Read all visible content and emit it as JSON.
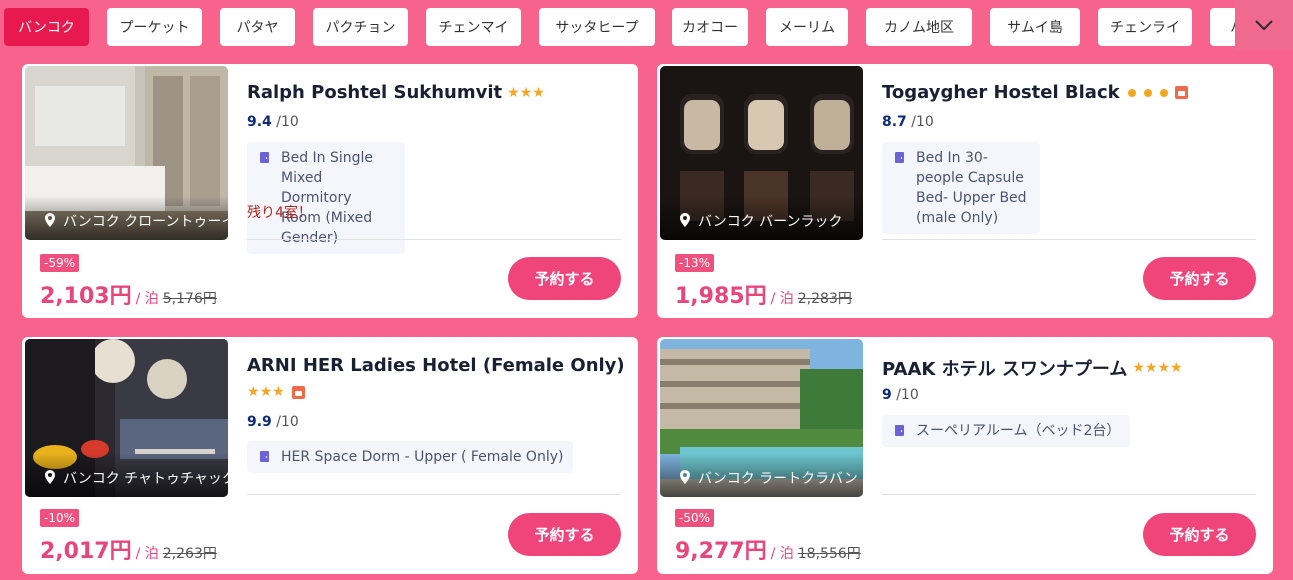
{
  "tabs": [
    {
      "label": "バンコク",
      "active": true
    },
    {
      "label": "プーケット"
    },
    {
      "label": "パタヤ"
    },
    {
      "label": "パクチョン"
    },
    {
      "label": "チェンマイ"
    },
    {
      "label": "サッタヒープ"
    },
    {
      "label": "カオコー"
    },
    {
      "label": "メーリム"
    },
    {
      "label": "カノム地区"
    },
    {
      "label": "サムイ島"
    },
    {
      "label": "チェンライ"
    },
    {
      "label": "ハ"
    }
  ],
  "tab_toggle_icon": "chevron-down-icon",
  "cta_label": "予約する",
  "per_night": "/ 泊",
  "score_out": "/10",
  "hotels": [
    {
      "name": "Ralph Poshtel Sukhumvit",
      "rating_icons": "3-stars",
      "score": "9.4",
      "location": "バンコク クローントゥーイ",
      "room": "Bed In Single Mixed Dormitory Room (Mixed Gender)",
      "urgency": "残り4室！",
      "discount": "-59%",
      "price": "2,103円",
      "old_price": "5,176円"
    },
    {
      "name": "Togaygher Hostel Black",
      "rating_icons": "3-dots-plus-thumb",
      "score": "8.7",
      "location": "バンコク バーンラック",
      "room": "Bed In 30-people Capsule Bed- Upper Bed (male Only)",
      "discount": "-13%",
      "price": "1,985円",
      "old_price": "2,283円"
    },
    {
      "name": "ARNI HER Ladies Hotel (Female Only)",
      "rating_icons": "3-stars-plus-thumb",
      "score": "9.9",
      "location": "バンコク チャトゥチャック",
      "room": "HER Space Dorm - Upper ( Female Only)",
      "discount": "-10%",
      "price": "2,017円",
      "old_price": "2,263円"
    },
    {
      "name": "PAAK ホテル スワンナプーム",
      "rating_icons": "4-stars",
      "score": "9",
      "location": "バンコク ラートクラバン",
      "room": "スーペリアルーム（ベッド2台）",
      "discount": "-50%",
      "price": "9,277円",
      "old_price": "18,556円"
    }
  ],
  "colors": {
    "background": "#f7638c",
    "active_tab": "#e8194f",
    "cta": "#f0457b",
    "price": "#e8457b",
    "star": "#f5a623"
  }
}
